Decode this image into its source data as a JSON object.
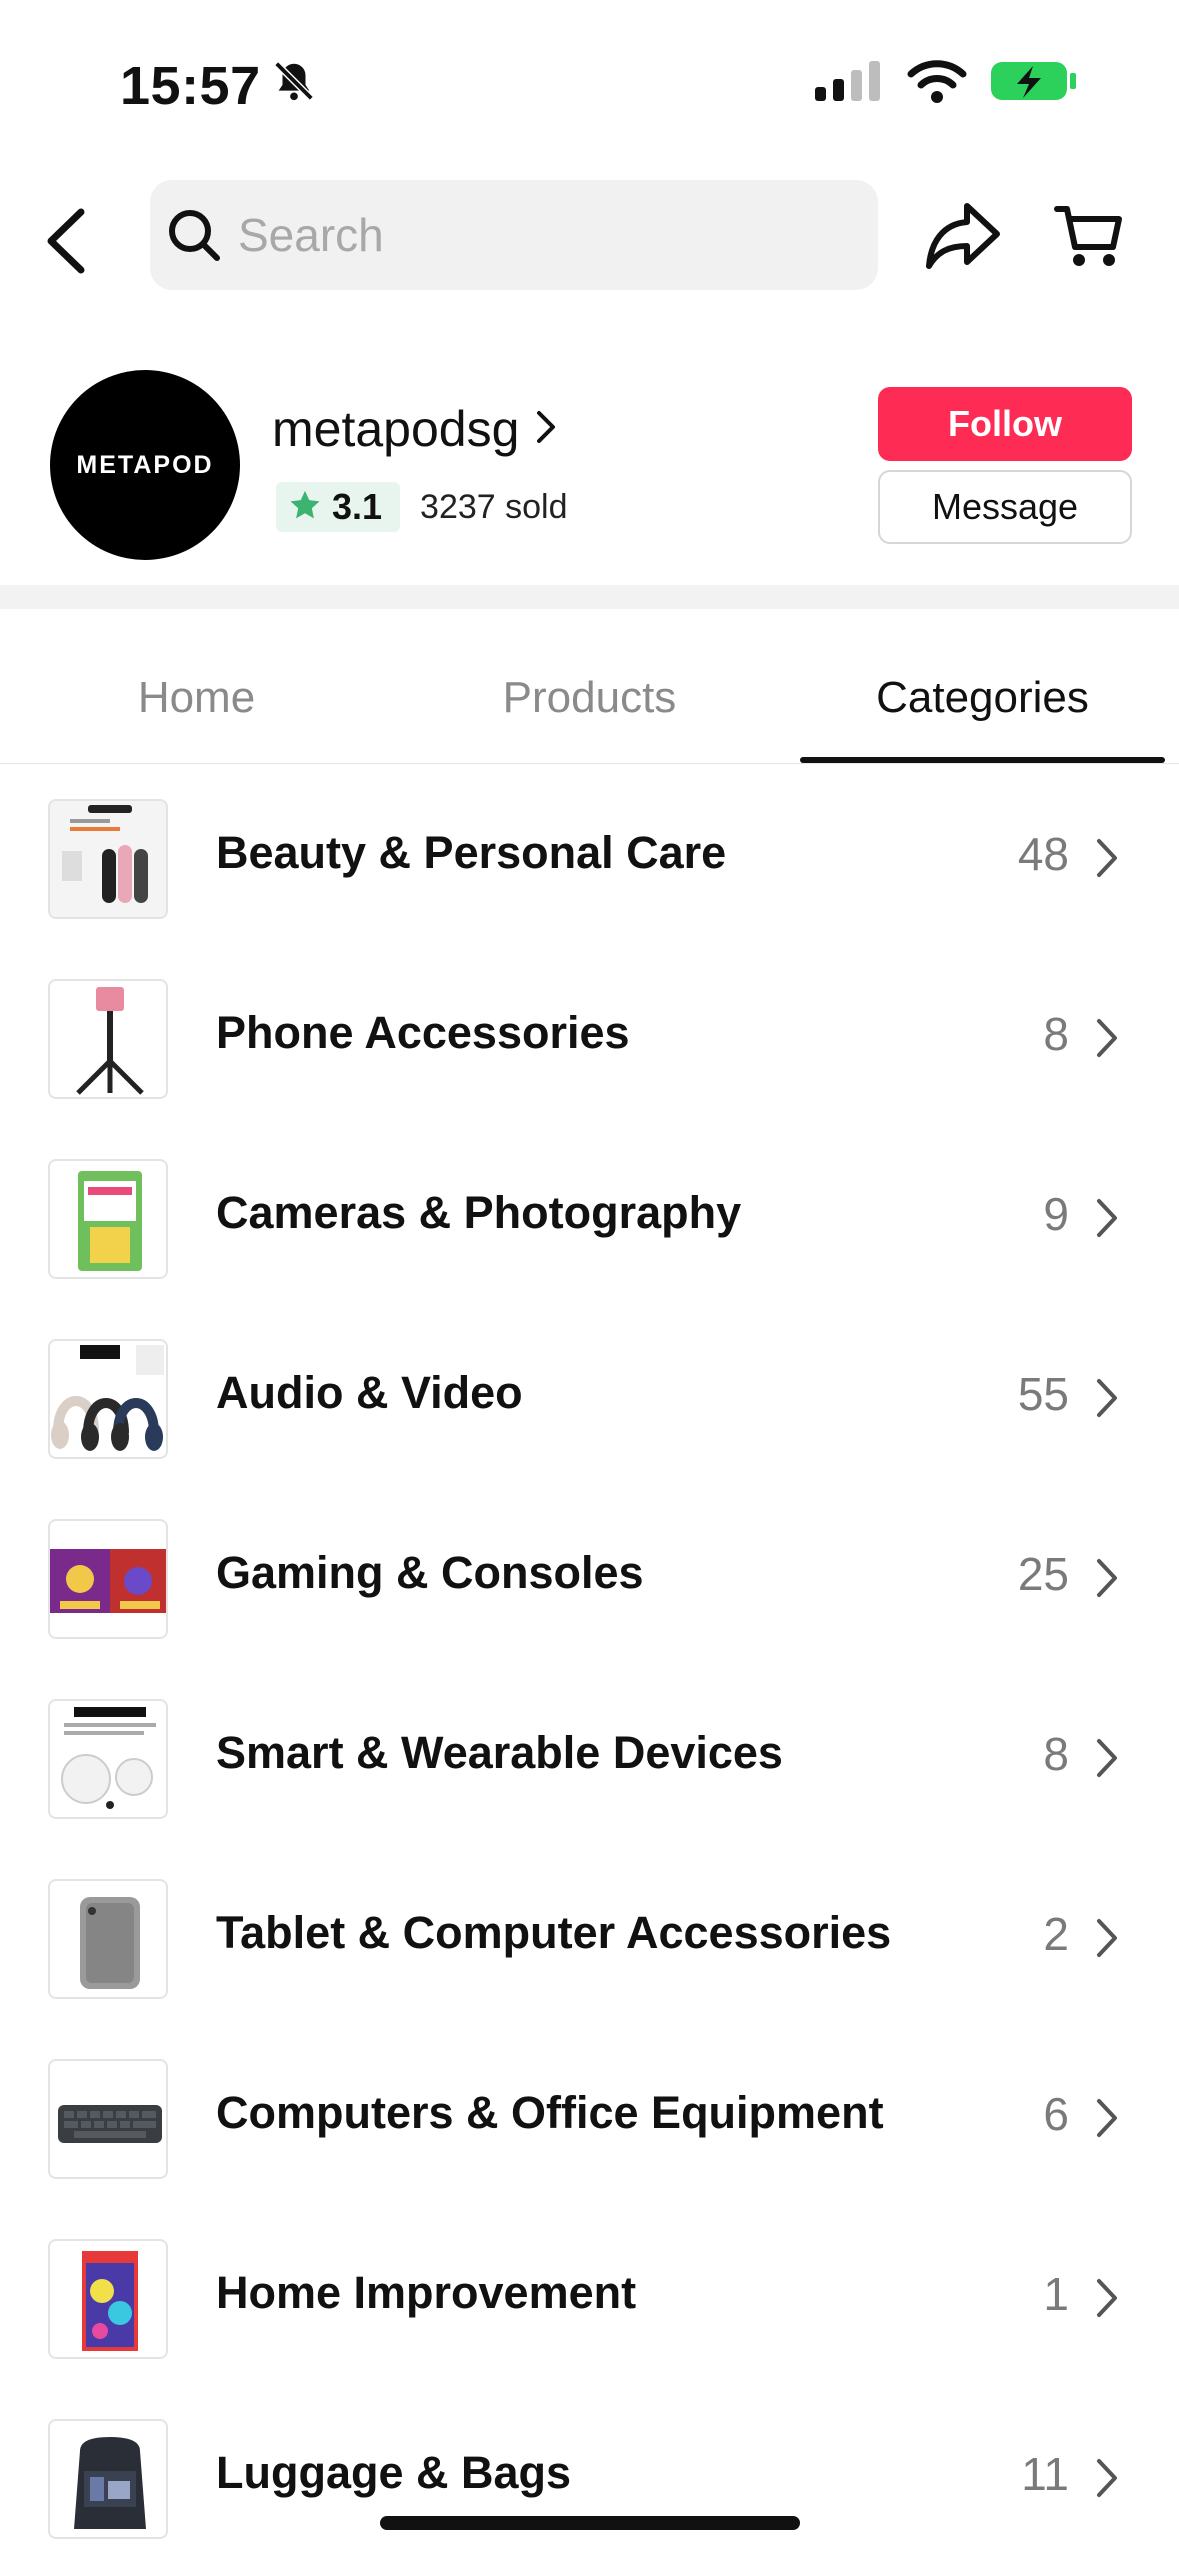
{
  "status_bar": {
    "time": "15:57",
    "icons": [
      "bell-slash-icon",
      "signal-icon",
      "wifi-icon",
      "battery-charging-icon"
    ],
    "battery_color": "#2bd15a"
  },
  "nav": {
    "back_icon": "chevron-left-icon",
    "search_placeholder": "Search",
    "share_icon": "share-arrow-icon",
    "cart_icon": "shopping-cart-icon"
  },
  "shop": {
    "logo_text": "METAPOD",
    "name": "metapodsg",
    "rating": "3.1",
    "sold": "3237 sold",
    "follow_label": "Follow",
    "message_label": "Message",
    "follow_color": "#fe2c55",
    "rating_star_color": "#3cb371"
  },
  "tabs": [
    {
      "label": "Home",
      "active": false
    },
    {
      "label": "Products",
      "active": false
    },
    {
      "label": "Categories",
      "active": true
    }
  ],
  "categories": [
    {
      "name": "Beauty & Personal Care",
      "count": "48",
      "thumb": "hair-tools-product"
    },
    {
      "name": "Phone Accessories",
      "count": "8",
      "thumb": "selfie-stick-tripod"
    },
    {
      "name": "Cameras & Photography",
      "count": "9",
      "thumb": "instax-film-box"
    },
    {
      "name": "Audio & Video",
      "count": "55",
      "thumb": "headphones-set"
    },
    {
      "name": "Gaming & Consoles",
      "count": "25",
      "thumb": "game-cover"
    },
    {
      "name": "Smart & Wearable Devices",
      "count": "8",
      "thumb": "smart-tags"
    },
    {
      "name": "Tablet & Computer Accessories",
      "count": "2",
      "thumb": "tablet-stand"
    },
    {
      "name": "Computers & Office Equipment",
      "count": "6",
      "thumb": "keyboard"
    },
    {
      "name": "Home Improvement",
      "count": "1",
      "thumb": "game-box-art"
    },
    {
      "name": "Luggage & Bags",
      "count": "11",
      "thumb": "backpack"
    }
  ]
}
